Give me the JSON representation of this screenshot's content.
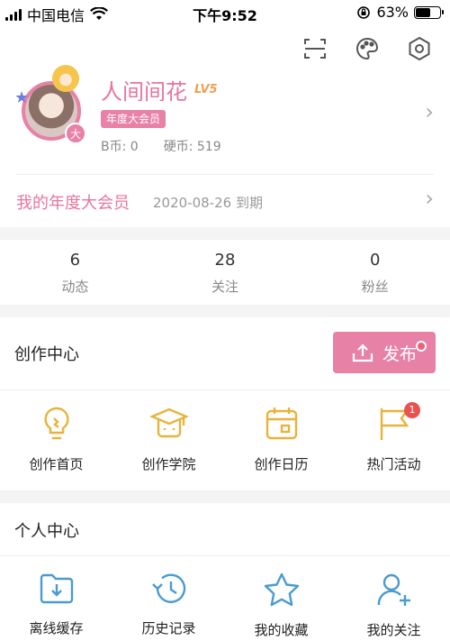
{
  "status_bar": {
    "carrier": "中国电信",
    "time": "下午9:52",
    "battery": "63%",
    "battery_level": 0.63
  },
  "header_icons": [
    "scan-icon",
    "palette-icon",
    "settings-icon"
  ],
  "profile": {
    "username": "人间间花",
    "level": "LV5",
    "vip_badge": "年度大会员",
    "avatar_badge": "大",
    "b_coin_label": "B币:",
    "b_coin_value": "0",
    "hard_coin_label": "硬币:",
    "hard_coin_value": "519"
  },
  "vip": {
    "title": "我的年度大会员",
    "date": "2020-08-26 到期"
  },
  "stats": [
    {
      "value": "6",
      "label": "动态"
    },
    {
      "value": "28",
      "label": "关注"
    },
    {
      "value": "0",
      "label": "粉丝"
    }
  ],
  "creation_center": {
    "title": "创作中心",
    "publish_label": "发布",
    "items": [
      {
        "icon": "lightbulb-icon",
        "label": "创作首页"
      },
      {
        "icon": "academy-icon",
        "label": "创作学院"
      },
      {
        "icon": "calendar-icon",
        "label": "创作日历"
      },
      {
        "icon": "flag-icon",
        "label": "热门活动",
        "badge": "1"
      }
    ]
  },
  "personal_center": {
    "title": "个人中心",
    "items": [
      {
        "icon": "download-folder-icon",
        "label": "离线缓存"
      },
      {
        "icon": "history-icon",
        "label": "历史记录"
      },
      {
        "icon": "star-icon",
        "label": "我的收藏"
      },
      {
        "icon": "add-user-icon",
        "label": "我的关注"
      }
    ]
  },
  "colors": {
    "pink": "#e881a6",
    "gold": "#e8b33a",
    "blue": "#4a9bd0"
  }
}
